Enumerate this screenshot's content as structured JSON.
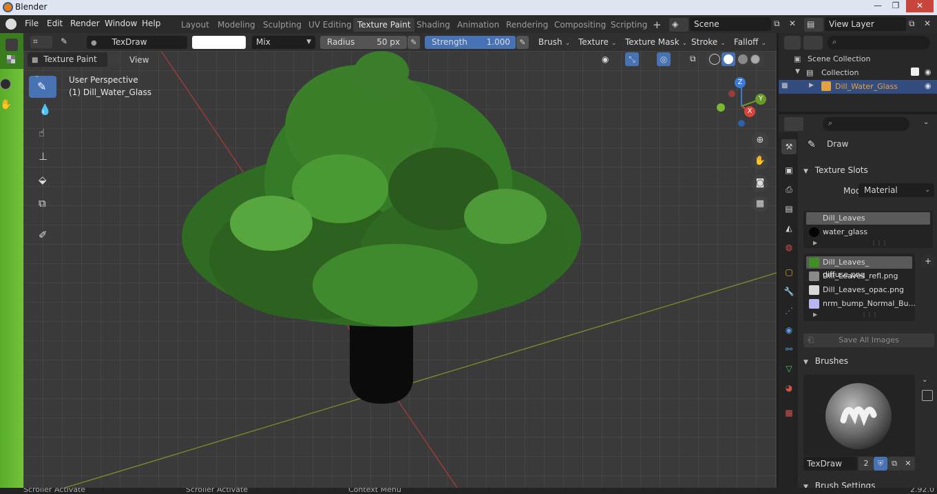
{
  "window": {
    "title": "Blender",
    "minimize": "—",
    "maximize": "❐",
    "close": "✕"
  },
  "menu": [
    "File",
    "Edit",
    "Render",
    "Window",
    "Help"
  ],
  "workspaces": [
    "Layout",
    "Modeling",
    "Sculpting",
    "UV Editing",
    "Texture Paint",
    "Shading",
    "Animation",
    "Rendering",
    "Compositing",
    "Scripting"
  ],
  "active_workspace": "Texture Paint",
  "add_workspace": "+",
  "scene": {
    "name": "Scene"
  },
  "view_layer": {
    "name": "View Layer"
  },
  "tool_header": {
    "brush_name": "TexDraw",
    "blend_mode": "Mix",
    "radius_label": "Radius",
    "radius_value": "50 px",
    "strength_label": "Strength",
    "strength_value": "1.000",
    "menus": [
      "Brush",
      "Texture",
      "Texture Mask",
      "Stroke",
      "Falloff"
    ]
  },
  "viewport_header": {
    "mode": "Texture Paint",
    "view_menu": "View"
  },
  "viewport": {
    "perspective": "User Perspective",
    "object_label": "(1) Dill_Water_Glass",
    "gizmo": {
      "z": "Z",
      "y": "Y",
      "x": "X"
    }
  },
  "outliner": {
    "scene_collection": "Scene Collection",
    "collection": "Collection",
    "object": "Dill_Water_Glass"
  },
  "properties": {
    "tool_name": "Draw",
    "texture_slots": {
      "header": "Texture Slots",
      "mode_label": "Mode",
      "mode_value": "Material",
      "materials": [
        {
          "name": "Dill_Leaves",
          "color": "#2d4a22",
          "selected": true
        },
        {
          "name": "water_glass",
          "color": "#050505",
          "selected": false
        }
      ],
      "images": [
        {
          "name": "Dill_Leaves_ diffuse.png",
          "color": "#3f8f22",
          "selected": true
        },
        {
          "name": "Dill_Leaves_refl.png",
          "color": "#8a8a8a",
          "selected": false
        },
        {
          "name": "Dill_Leaves_opac.png",
          "color": "#d8d8d8",
          "selected": false
        },
        {
          "name": "nrm_bump_Normal_Bu...",
          "color": "#b7b5f2",
          "selected": false
        }
      ],
      "save_all": "Save All Images"
    },
    "brushes": {
      "header": "Brushes",
      "brush_name": "TexDraw",
      "users": "2"
    },
    "brush_settings_header": "Brush Settings"
  },
  "statusbar": [
    "Scroller Activate",
    "Scroller Activate",
    "Context Menu",
    "2.92.0"
  ],
  "colors": {
    "accent": "#4772b3",
    "header": "#303030",
    "viewport": "#3a3a3a",
    "selected_object": "#f0a030"
  }
}
